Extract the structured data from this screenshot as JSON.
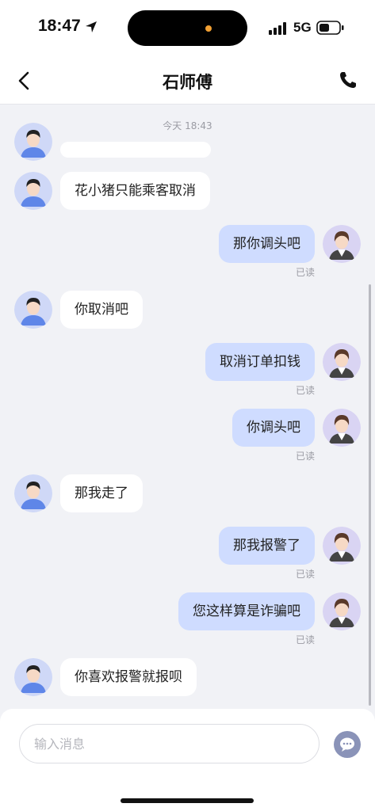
{
  "status_bar": {
    "time": "18:47",
    "network": "5G"
  },
  "nav": {
    "title": "石师傅"
  },
  "chat": {
    "timestamp": "今天 18:43",
    "read_label": "已读",
    "messages": [
      {
        "side": "in",
        "text": "花小猪只能乘客取消"
      },
      {
        "side": "out",
        "text": "那你调头吧",
        "status": "已读"
      },
      {
        "side": "in",
        "text": "你取消吧"
      },
      {
        "side": "out",
        "text": "取消订单扣钱",
        "status": "已读"
      },
      {
        "side": "out",
        "text": "你调头吧",
        "status": "已读"
      },
      {
        "side": "in",
        "text": "那我走了"
      },
      {
        "side": "out",
        "text": "那我报警了",
        "status": "已读"
      },
      {
        "side": "out",
        "text": "您这样算是诈骗吧",
        "status": "已读"
      },
      {
        "side": "in",
        "text": "你喜欢报警就报呗"
      }
    ]
  },
  "input": {
    "placeholder": "输入消息",
    "value": ""
  },
  "colors": {
    "page_bg": "#f1f2f6",
    "bubble_out": "#cfdcff",
    "bubble_in": "#ffffff",
    "accent_dot": "#f2a033"
  },
  "icons": [
    "location-arrow-icon",
    "signal-bars-icon",
    "battery-icon",
    "back-chevron-icon",
    "phone-icon",
    "chat-bubble-icon"
  ]
}
